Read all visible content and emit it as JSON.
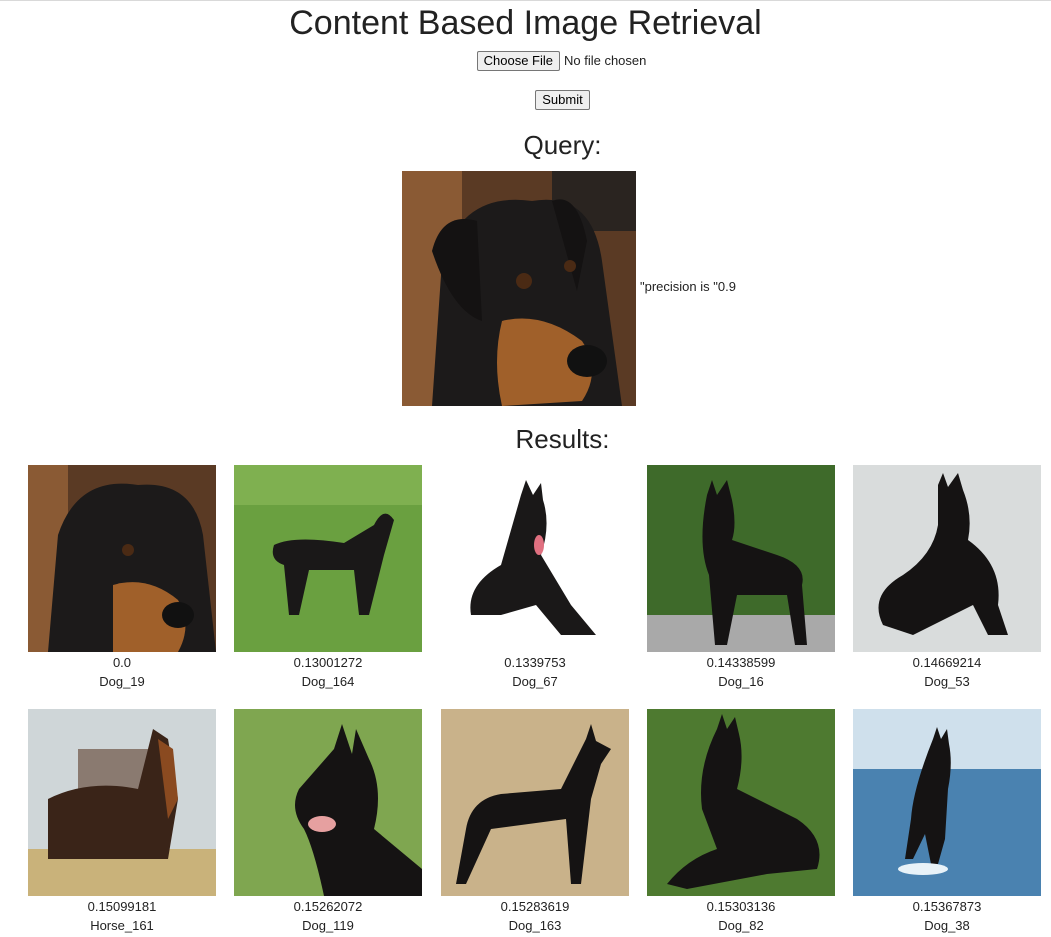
{
  "page": {
    "title": "Content Based Image Retrieval",
    "file_button": "Choose File",
    "file_status": "No file chosen",
    "submit": "Submit"
  },
  "query": {
    "heading": "Query:",
    "precision_text": "\"precision is \"0.9"
  },
  "results": {
    "heading": "Results:",
    "items": [
      {
        "score": "0.0",
        "name": "Dog_19"
      },
      {
        "score": "0.13001272",
        "name": "Dog_164"
      },
      {
        "score": "0.1339753",
        "name": "Dog_67"
      },
      {
        "score": "0.14338599",
        "name": "Dog_16"
      },
      {
        "score": "0.14669214",
        "name": "Dog_53"
      },
      {
        "score": "0.15099181",
        "name": "Horse_161"
      },
      {
        "score": "0.15262072",
        "name": "Dog_119"
      },
      {
        "score": "0.15283619",
        "name": "Dog_163"
      },
      {
        "score": "0.15303136",
        "name": "Dog_82"
      },
      {
        "score": "0.15367873",
        "name": "Dog_38"
      }
    ]
  }
}
